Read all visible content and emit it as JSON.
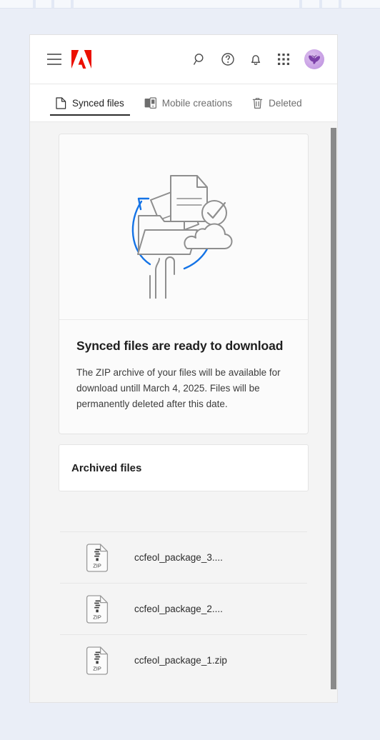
{
  "window": {
    "brand_color": "#eb1000",
    "accent_color": "#1473e6"
  },
  "header": {
    "menu_icon": "hamburger-menu-icon",
    "logo_icon": "adobe-logo",
    "actions": [
      {
        "icon": "search-icon",
        "label": "Search"
      },
      {
        "icon": "help-circle-icon",
        "label": "Help"
      },
      {
        "icon": "bell-icon",
        "label": "Notifications"
      },
      {
        "icon": "app-grid-icon",
        "label": "Apps"
      }
    ],
    "avatar": {
      "icon": "avatar-butterfly",
      "label": "Account"
    }
  },
  "tabs": [
    {
      "label": "Synced files",
      "icon": "file-icon",
      "active": true
    },
    {
      "label": "Mobile creations",
      "icon": "mobile-device-icon",
      "active": false
    },
    {
      "label": "Deleted",
      "icon": "trash-icon",
      "active": false
    }
  ],
  "hero": {
    "illustration": "sync-files-to-cloud-illustration",
    "title": "Synced files are ready to download",
    "body": "The ZIP archive of your files will be available for download untill March 4, 2025. Files will be permanently deleted after this date."
  },
  "archived": {
    "title": "Archived files"
  },
  "files": [
    {
      "name": "ccfeol_package_3....",
      "icon": "zip-file-icon",
      "type_label": "ZIP"
    },
    {
      "name": "ccfeol_package_2....",
      "icon": "zip-file-icon",
      "type_label": "ZIP"
    },
    {
      "name": "ccfeol_package_1.zip",
      "icon": "zip-file-icon",
      "type_label": "ZIP"
    }
  ],
  "scrollbar": {
    "name": "content-scrollbar"
  }
}
